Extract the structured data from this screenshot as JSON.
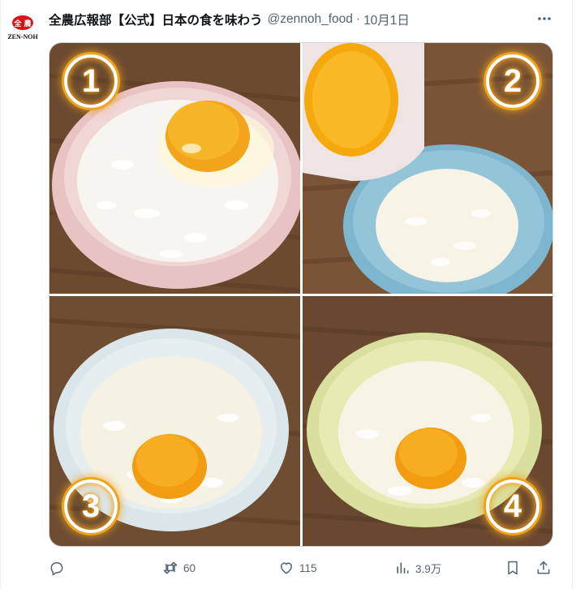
{
  "tweet": {
    "author": "全農広報部【公式】日本の食を味わう",
    "handle": "@zennoh_food",
    "separator": "·",
    "date": "10月1日",
    "avatar": {
      "top_text": "全 農",
      "bottom_text": "ZEN-NOH",
      "color": "#d7141a"
    },
    "more_icon": "more-horizontal-icon"
  },
  "media": {
    "badges": [
      "1",
      "2",
      "3",
      "4"
    ],
    "badge_glow_color": "#f0a21c"
  },
  "actions": {
    "reply_count": "",
    "retweet_count": "60",
    "like_count": "115",
    "views_count": "3.9万"
  },
  "colors": {
    "text": "#0f1419",
    "secondary": "#536471",
    "border": "#cfd9de"
  }
}
